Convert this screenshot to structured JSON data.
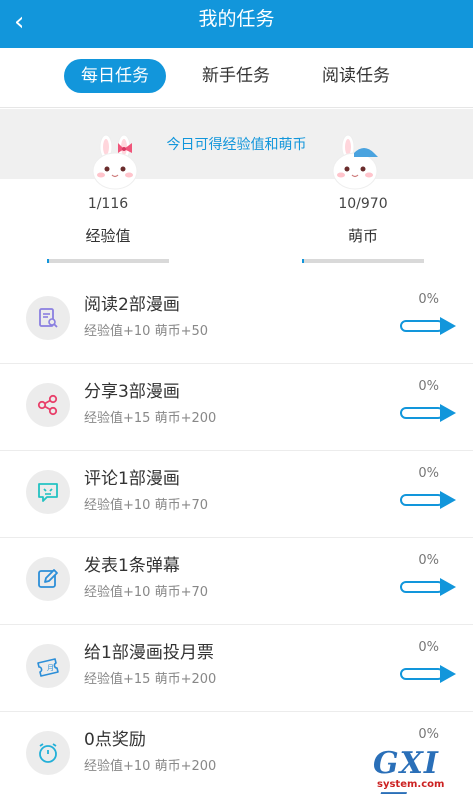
{
  "header": {
    "back_icon": "chevron-left-icon",
    "back_glyph": "‹",
    "title": "我的任务"
  },
  "tabs": [
    {
      "label": "每日任务",
      "active": true
    },
    {
      "label": "新手任务",
      "active": false
    },
    {
      "label": "阅读任务",
      "active": false
    }
  ],
  "banner": {
    "text": "今日可得经验值和萌币"
  },
  "stats": [
    {
      "value": "1/116",
      "label": "经验值",
      "progress": 0.0086
    },
    {
      "value": "10/970",
      "label": "萌币",
      "progress": 0.0103
    }
  ],
  "tasks": [
    {
      "name": "阅读2部漫画",
      "reward": "经验值+10 萌币+50",
      "percent": "0%",
      "icon": "read-document-icon",
      "icon_color": "#8a7fe0"
    },
    {
      "name": "分享3部漫画",
      "reward": "经验值+15 萌币+200",
      "percent": "0%",
      "icon": "share-icon",
      "icon_color": "#e8406a"
    },
    {
      "name": "评论1部漫画",
      "reward": "经验值+10 萌币+70",
      "percent": "0%",
      "icon": "comment-icon",
      "icon_color": "#23c2c2"
    },
    {
      "name": "发表1条弹幕",
      "reward": "经验值+10 萌币+70",
      "percent": "0%",
      "icon": "edit-icon",
      "icon_color": "#2d8fd8"
    },
    {
      "name": "给1部漫画投月票",
      "reward": "经验值+15 萌币+200",
      "percent": "0%",
      "icon": "ticket-icon",
      "icon_color": "#2d8fd8"
    },
    {
      "name": "0点奖励",
      "reward": "经验值+10 萌币+200",
      "percent": "0%",
      "icon": "alarm-clock-icon",
      "icon_color": "#23b0d8"
    }
  ],
  "colors": {
    "primary": "#1296db",
    "page_bg": "#ffffff",
    "banner_bg": "#f0f0f0"
  },
  "watermark": {
    "logo": "GXI网",
    "domain": "system.com"
  }
}
